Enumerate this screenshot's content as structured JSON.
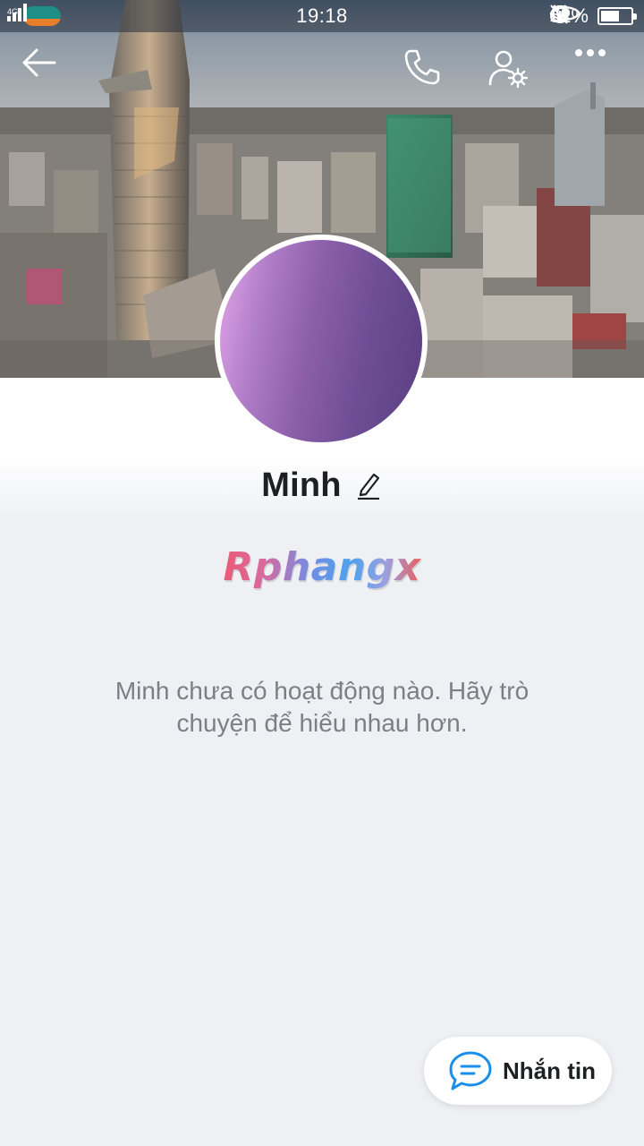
{
  "status_bar": {
    "network_type": "4G",
    "time": "19:18",
    "battery_percent": "62%",
    "battery_level": 0.62,
    "icons": [
      "signal-icon",
      "carrier-logo",
      "signal-icon",
      "bell-off-icon",
      "alarm-icon",
      "eye-comfort-icon",
      "moon-icon",
      "battery-icon"
    ]
  },
  "header": {
    "back_icon": "arrow-left-icon",
    "call_icon": "phone-icon",
    "settings_icon": "user-settings-icon",
    "more_icon": "more-horizontal-icon"
  },
  "profile": {
    "name": "Minh",
    "edit_icon": "pencil-icon",
    "avatar_gradient": [
      "#e3a6ea",
      "#5a3f80"
    ]
  },
  "watermark": {
    "text": "Rphangx"
  },
  "empty_state": {
    "message": "Minh chưa có hoạt động nào. Hãy trò chuyện để hiểu nhau hơn."
  },
  "message_button": {
    "label": "Nhắn tin",
    "icon": "chat-bubble-icon",
    "accent_color": "#1a8ee8"
  },
  "colors": {
    "background": "#eff0f4",
    "accent": "#1a8ee8",
    "text_primary": "#1e1f22",
    "text_secondary": "#7c7f86"
  }
}
